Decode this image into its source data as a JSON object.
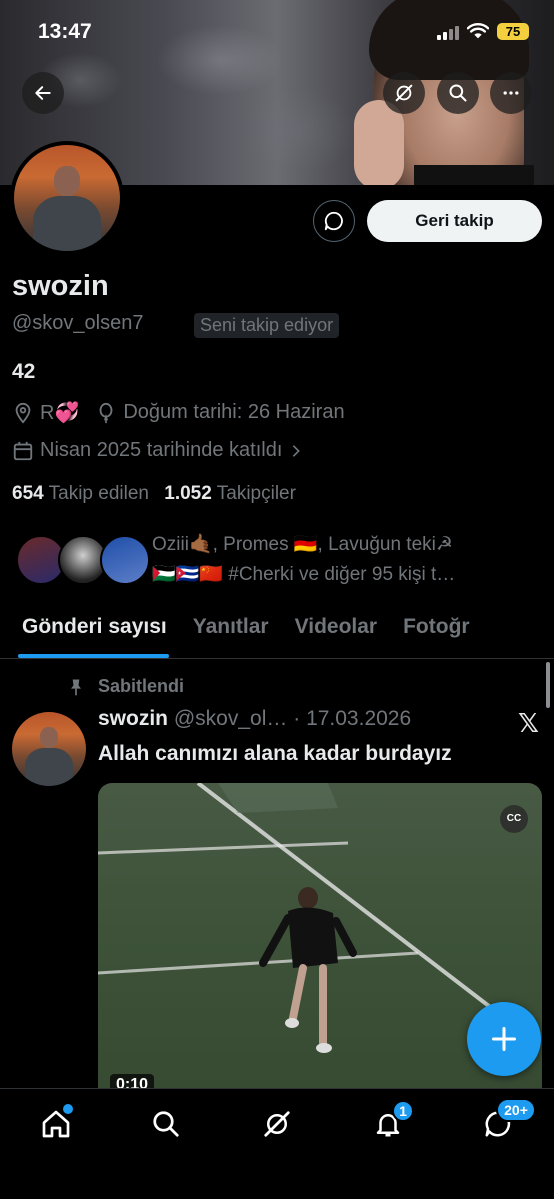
{
  "status_bar": {
    "time": "13:47",
    "battery": "75"
  },
  "profile": {
    "name": "swozin",
    "handle": "@skov_olsen7",
    "follows_you": "Seni takip ediyor",
    "bio": "42",
    "location": "R💞",
    "birthday": "Doğum tarihi: 26 Haziran",
    "joined": "Nisan 2025 tarihinde katıldı",
    "following_count": "654",
    "following_label": "Takip edilen",
    "followers_count": "1.052",
    "followers_label": "Takipçiler",
    "known_followers_line1": "Oziii🤙🏾, Promes 🇩🇪, Lavuğun teki☭",
    "known_followers_line2": "🇵🇸🇨🇺🇨🇳 #Cherki ve diğer 95 kişi t…",
    "follow_back_label": "Geri takip"
  },
  "tabs": [
    {
      "label": "Gönderi sayısı",
      "active": true
    },
    {
      "label": "Yanıtlar",
      "active": false
    },
    {
      "label": "Videolar",
      "active": false
    },
    {
      "label": "Fotoğr",
      "active": false
    }
  ],
  "post": {
    "pinned_label": "Sabitlendi",
    "author_name": "swozin",
    "author_handle": "@skov_ol…",
    "date": "17.03.2026",
    "text": "Allah canımızı alana kadar burdayız",
    "cc_label": "CC",
    "duration": "0:10"
  },
  "bottom_nav": {
    "notifications_badge": "1",
    "messages_badge": "20+"
  },
  "colors": {
    "accent": "#1d9bf0",
    "background": "#000000",
    "text": "#e7e9ea",
    "muted": "#71767b"
  },
  "icons": [
    "back-arrow-icon",
    "grok-icon",
    "search-icon",
    "more-icon",
    "message-icon",
    "location-icon",
    "balloon-icon",
    "calendar-icon",
    "pin-icon",
    "x-logo-icon",
    "plus-icon",
    "home-icon",
    "notifications-icon",
    "messages-icon"
  ]
}
